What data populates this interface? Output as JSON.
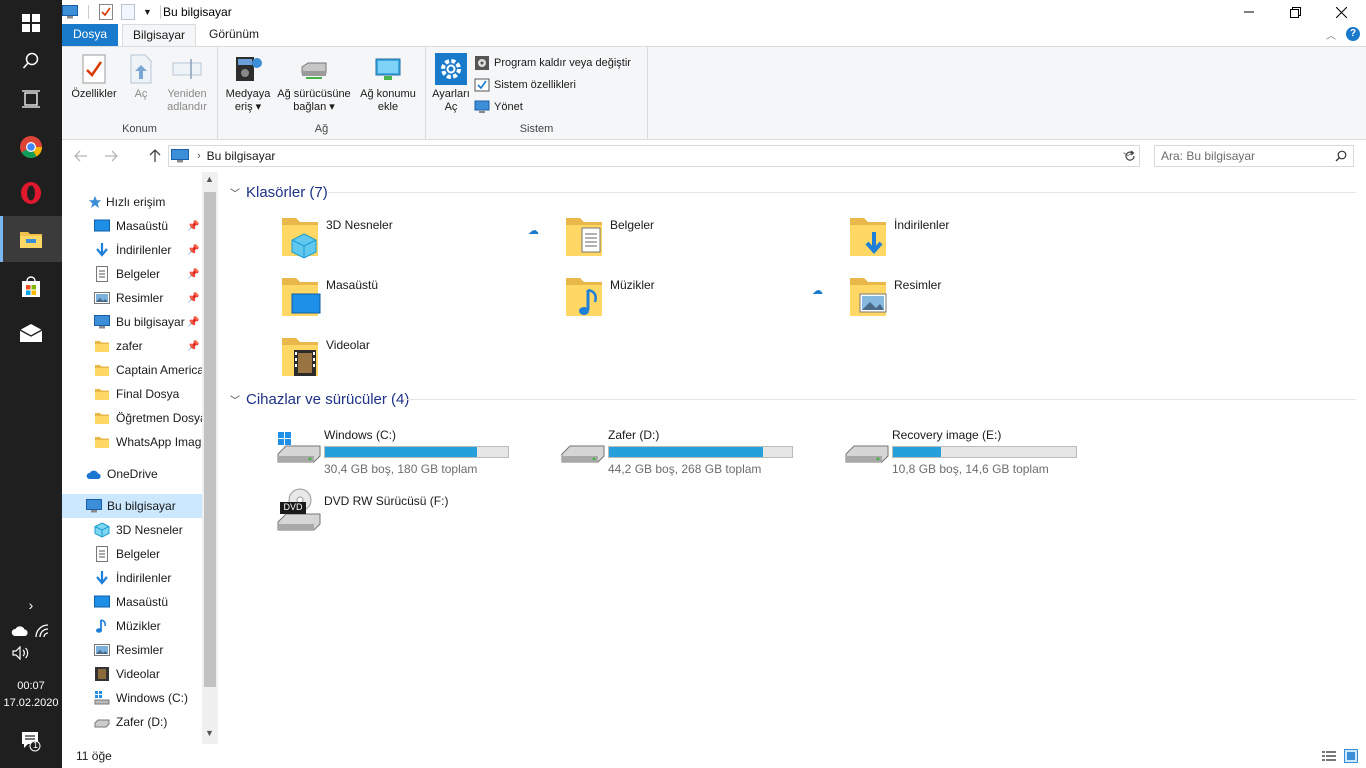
{
  "window": {
    "title": "Bu bilgisayar"
  },
  "ribbon": {
    "tabs": [
      "Dosya",
      "Bilgisayar",
      "Görünüm"
    ],
    "groups": {
      "konum": {
        "label": "Konum",
        "buttons": [
          "Özellikler",
          "Aç",
          "Yeniden adlandır"
        ]
      },
      "ag": {
        "label": "Ağ",
        "media_line1": "Medyaya",
        "media_line2": "eriş",
        "map_line1": "Ağ sürücüsüne",
        "map_line2": "bağlan",
        "addloc_line1": "Ağ konumu",
        "addloc_line2": "ekle"
      },
      "sistem": {
        "label": "Sistem",
        "settings_line1": "Ayarları",
        "settings_line2": "Aç",
        "uninstall": "Program kaldır veya değiştir",
        "sysprops": "Sistem özellikleri",
        "manage": "Yönet"
      }
    }
  },
  "address": {
    "path": "Bu bilgisayar",
    "search_placeholder": "Ara: Bu bilgisayar"
  },
  "nav": {
    "quick_access": "Hızlı erişim",
    "quick_items": [
      "Masaüstü",
      "İndirilenler",
      "Belgeler",
      "Resimler",
      "Bu bilgisayar",
      "zafer",
      "Captain America",
      "Final Dosya",
      "Öğretmen Dosya",
      "WhatsApp Imag"
    ],
    "onedrive": "OneDrive",
    "this_pc": "Bu bilgisayar",
    "pc_items": [
      "3D Nesneler",
      "Belgeler",
      "İndirilenler",
      "Masaüstü",
      "Müzikler",
      "Resimler",
      "Videolar",
      "Windows (C:)",
      "Zafer (D:)"
    ]
  },
  "content": {
    "folders_header": "Klasörler (7)",
    "folders": [
      "3D Nesneler",
      "Belgeler",
      "İndirilenler",
      "Masaüstü",
      "Müzikler",
      "Resimler",
      "Videolar"
    ],
    "drives_header": "Cihazlar ve sürücüler (4)",
    "drives": [
      {
        "name": "Windows (C:)",
        "info": "30,4 GB boş, 180 GB toplam",
        "used_fraction": 0.83
      },
      {
        "name": "Zafer (D:)",
        "info": "44,2 GB boş, 268 GB toplam",
        "used_fraction": 0.84
      },
      {
        "name": "Recovery image (E:)",
        "info": "10,8 GB boş, 14,6 GB toplam",
        "used_fraction": 0.26
      }
    ],
    "dvd": {
      "name": "DVD RW Sürücüsü (F:)",
      "label": "DVD"
    }
  },
  "status": {
    "count": "11 öğe"
  },
  "tray": {
    "time": "00:07",
    "date": "17.02.2020",
    "notifications": "1"
  }
}
